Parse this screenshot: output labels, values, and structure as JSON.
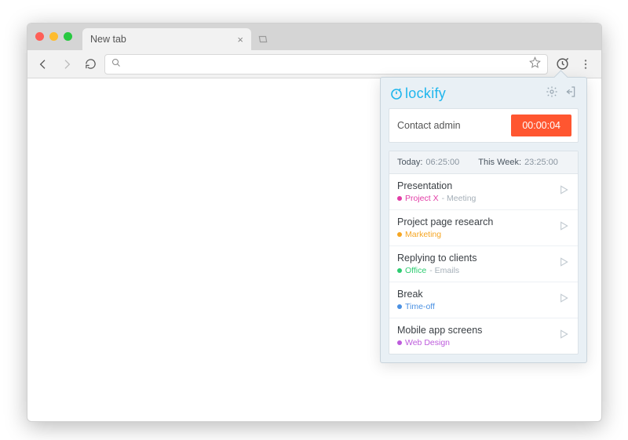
{
  "browser": {
    "tab_title": "New tab",
    "close_glyph": "×",
    "newtab_glyph": "⊡"
  },
  "popup": {
    "logo_text": "lockify",
    "timer": {
      "label": "Contact admin",
      "elapsed": "00:00:04"
    },
    "summary": {
      "today_label": "Today:",
      "today_value": "06:25:00",
      "week_label": "This Week:",
      "week_value": "23:25:00"
    },
    "entries": [
      {
        "title": "Presentation",
        "project": "Project X",
        "project_color": "#e23ca6",
        "task": "Meeting"
      },
      {
        "title": "Project page research",
        "project": "Marketing",
        "project_color": "#f5a623",
        "task": ""
      },
      {
        "title": "Replying to clients",
        "project": "Office",
        "project_color": "#2ecc71",
        "task": "Emails"
      },
      {
        "title": "Break",
        "project": "Time-off",
        "project_color": "#4a90e2",
        "task": ""
      },
      {
        "title": "Mobile app screens",
        "project": "Web Design",
        "project_color": "#bd5bdc",
        "task": ""
      }
    ]
  }
}
